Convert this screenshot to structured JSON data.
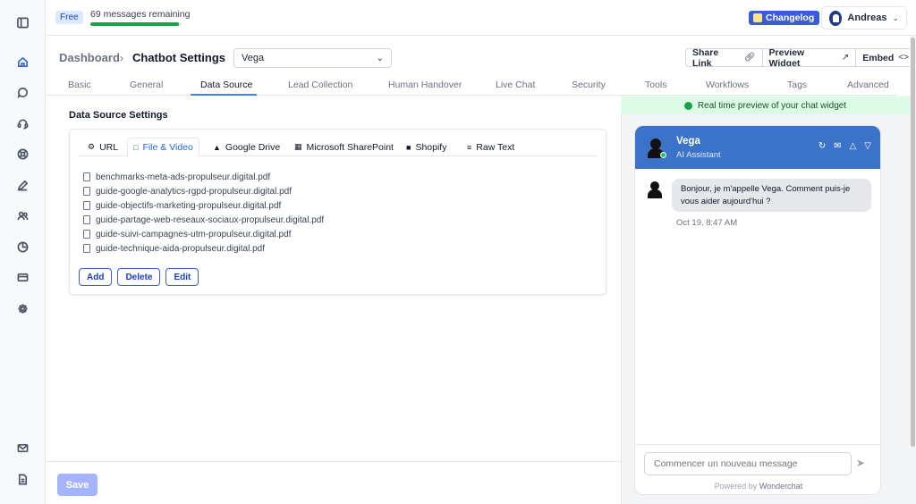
{
  "plan": {
    "badge": "Free",
    "messages_remaining": "69 messages remaining",
    "progress": 0.97
  },
  "topbar": {
    "changelog": "Changelog",
    "user_name": "Andreas"
  },
  "header": {
    "breadcrumb_root": "Dashboard",
    "breadcrumb_current": "Chatbot Settings",
    "bot_select_value": "Vega",
    "share_link": "Share Link",
    "preview_widget": "Preview Widget",
    "embed": "Embed"
  },
  "tabs": [
    "Basic",
    "General",
    "Data Source",
    "Lead Collection",
    "Human Handover",
    "Live Chat",
    "Security",
    "Tools",
    "Workflows",
    "Tags",
    "Advanced"
  ],
  "active_tab": "Data Source",
  "data_source": {
    "title": "Data Source Settings",
    "source_tabs": [
      "URL",
      "File & Video",
      "Google Drive",
      "Microsoft SharePoint",
      "Shopify",
      "Raw Text"
    ],
    "active_source": "File & Video",
    "files": [
      "benchmarks-meta-ads-propulseur.digital.pdf",
      "guide-google-analytics-rgpd-propulseur.digital.pdf",
      "guide-objectifs-marketing-propulseur.digital.pdf",
      "guide-partage-web-reseaux-sociaux-propulseur.digital.pdf",
      "guide-suivi-campagnes-utm-propulseur.digital.pdf",
      "guide-technique-aida-propulseur.digital.pdf"
    ],
    "add": "Add",
    "delete": "Delete",
    "edit": "Edit"
  },
  "footer": {
    "save": "Save"
  },
  "preview": {
    "banner": "Real time preview of your chat widget",
    "bot_name": "Vega",
    "bot_role": "AI Assistant",
    "greeting": "Bonjour, je m'appelle Vega. Comment puis-je vous aider aujourd'hui ?",
    "time": "Oct 19, 8:47 AM",
    "input_placeholder": "Commencer un nouveau message",
    "powered_prefix": "Powered by",
    "powered_brand": "Wonderchat"
  },
  "colors": {
    "accent": "#3b73c8",
    "primary_button": "#3b5bdb",
    "success": "#16a34a"
  }
}
